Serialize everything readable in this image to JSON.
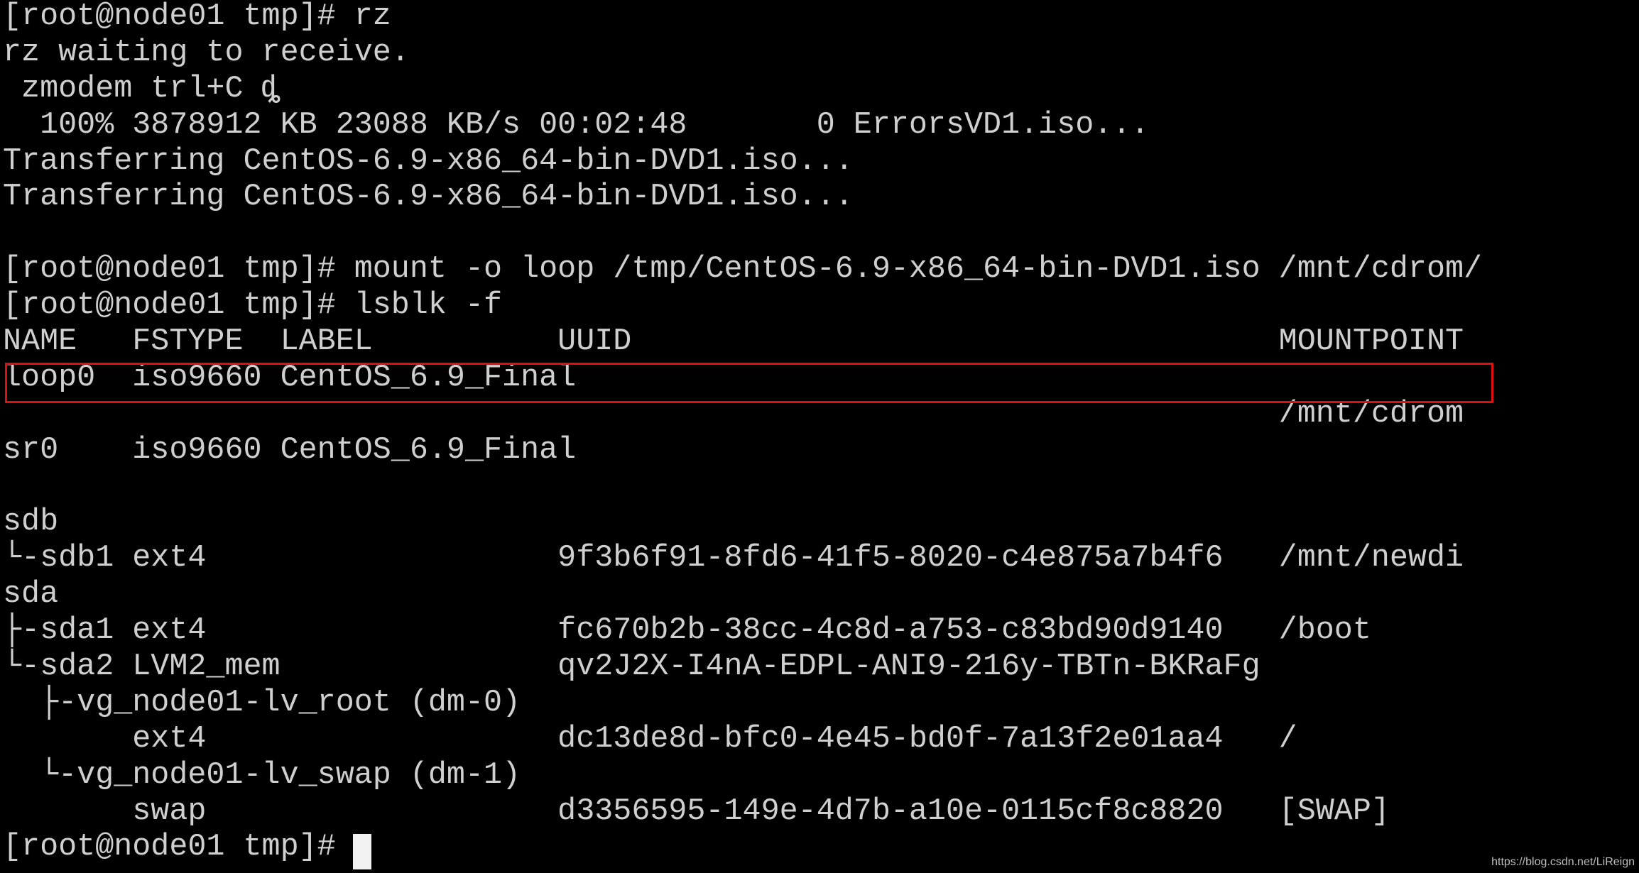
{
  "terminal": {
    "lines": [
      "[root@node01 tmp]# rz",
      "rz waiting to receive.",
      " zmodem trl+C ȡ",
      "  100% 3878912 KB 23088 KB/s 00:02:48       0 ErrorsVD1.iso...",
      "Transferring CentOS-6.9-x86_64-bin-DVD1.iso...",
      "Transferring CentOS-6.9-x86_64-bin-DVD1.iso...",
      "",
      "[root@node01 tmp]# mount -o loop /tmp/CentOS-6.9-x86_64-bin-DVD1.iso /mnt/cdrom/",
      "[root@node01 tmp]# lsblk -f",
      "NAME   FSTYPE  LABEL          UUID                                   MOUNTPOINT",
      "loop0  iso9660 CentOS_6.9_Final",
      "                                                                     /mnt/cdrom",
      "sr0    iso9660 CentOS_6.9_Final",
      "",
      "sdb",
      "└-sdb1 ext4                   9f3b6f91-8fd6-41f5-8020-c4e875a7b4f6   /mnt/newdi",
      "sda",
      "├-sda1 ext4                   fc670b2b-38cc-4c8d-a753-c83bd90d9140   /boot",
      "└-sda2 LVM2_mem               qv2J2X-I4nA-EDPL-ANI9-216y-TBTn-BKRaFg",
      "  ├-vg_node01-lv_root (dm-0)",
      "       ext4                   dc13de8d-bfc0-4e45-bd0f-7a13f2e01aa4   /",
      "  └-vg_node01-lv_swap (dm-1)",
      "       swap                   d3356595-149e-4d7b-a10e-0115cf8c8820   [SWAP]",
      "[root@node01 tmp]# "
    ]
  },
  "highlight_color": "#e01010",
  "watermark": "https://blog.csdn.net/LiReign"
}
